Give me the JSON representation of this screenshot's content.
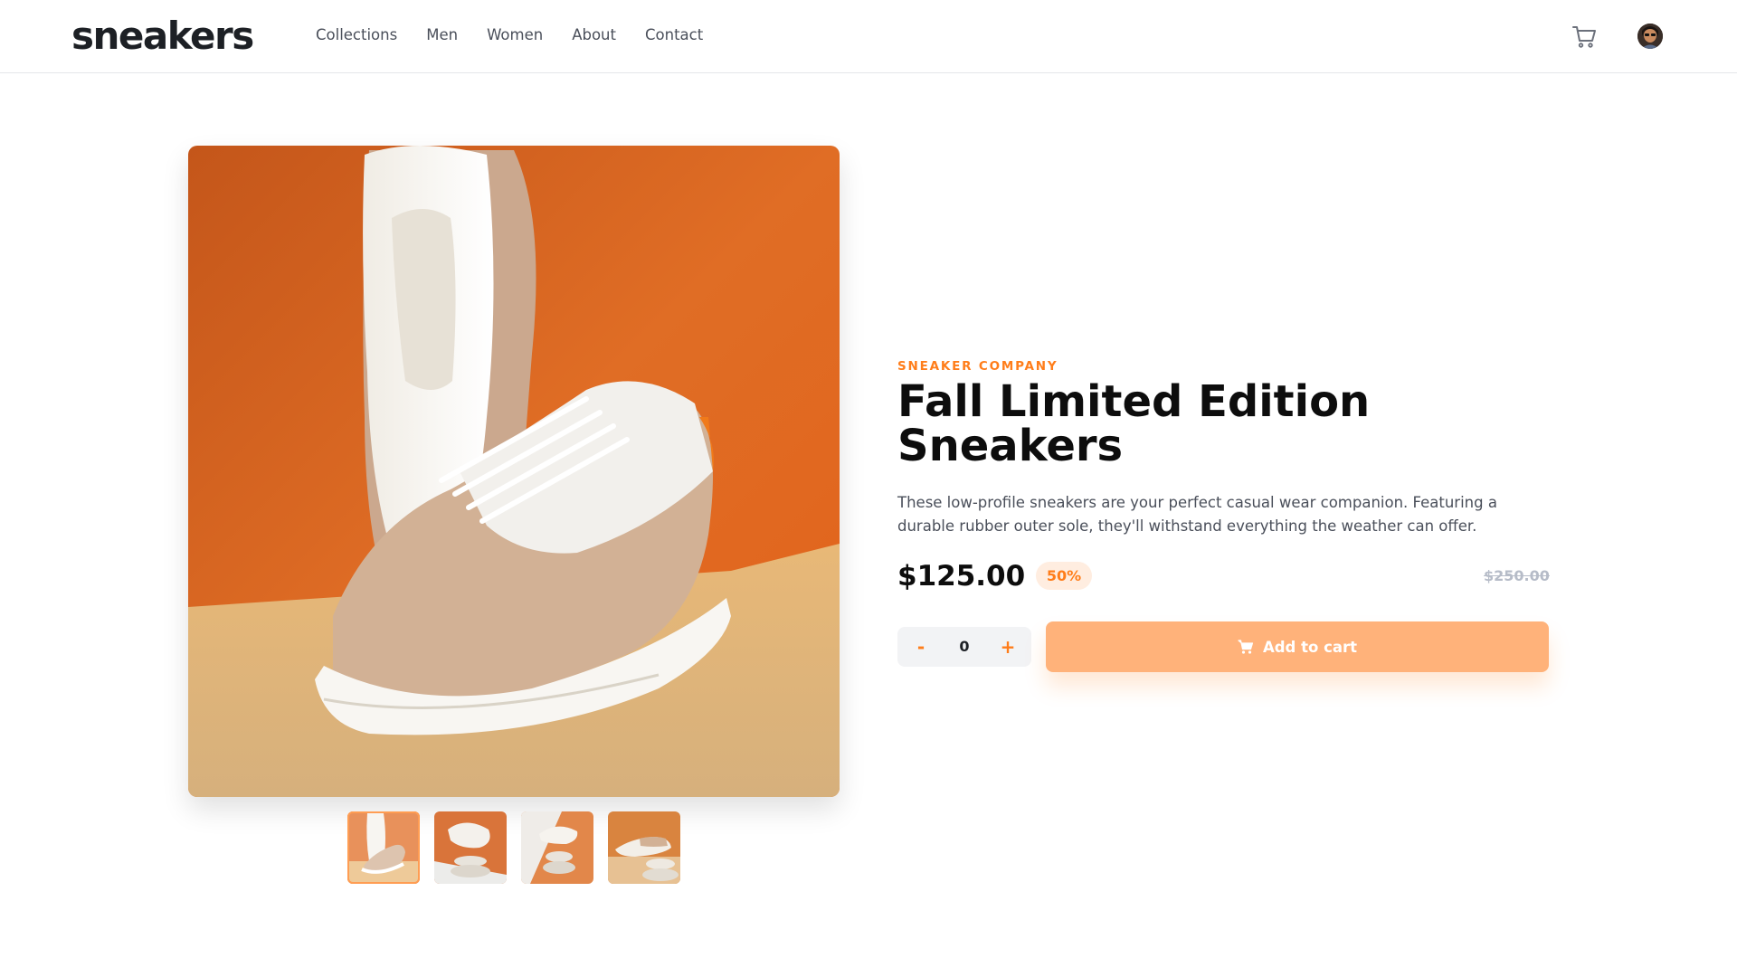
{
  "header": {
    "logo": "sneakers",
    "nav": [
      "Collections",
      "Men",
      "Women",
      "About",
      "Contact"
    ],
    "cart_icon": "cart-icon",
    "avatar_icon": "avatar"
  },
  "gallery": {
    "main_image": "sneaker-product-photo",
    "thumbnails": [
      "thumbnail-1",
      "thumbnail-2",
      "thumbnail-3",
      "thumbnail-4"
    ],
    "active_thumbnail": 1
  },
  "product": {
    "company": "SNEAKER COMPANY",
    "title_line1": "Fall Limited Edition",
    "title_line2": "Sneakers",
    "description": "These low-profile sneakers are your perfect casual wear companion. Featuring a durable rubber outer sole, they'll withstand everything the weather can offer.",
    "price": "$125.00",
    "discount": "50%",
    "old_price": "$250.00"
  },
  "cart_controls": {
    "minus": "-",
    "quantity": "0",
    "plus": "+",
    "add_label": "Add to cart"
  },
  "colors": {
    "accent": "#ff7d1a",
    "accent_light": "#ffede0",
    "button": "#ffb27a",
    "text_dark": "#1d2025",
    "text_muted": "#4a4f5a"
  }
}
